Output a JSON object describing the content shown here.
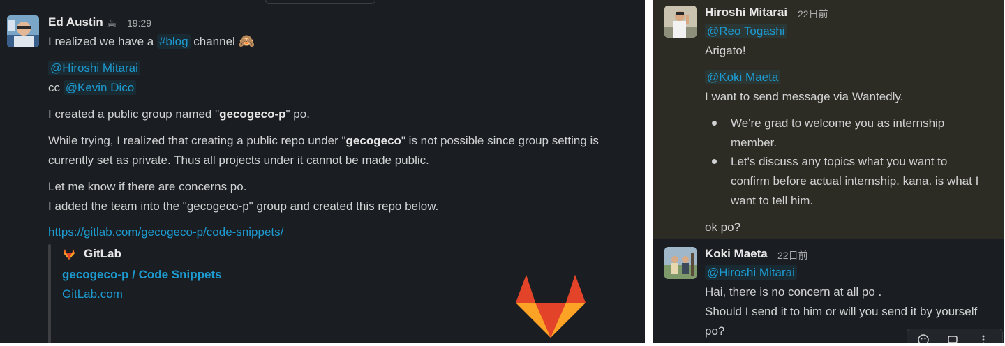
{
  "left": {
    "author": "Ed Austin",
    "status_emoji": "☕",
    "time": "19:29",
    "line1_pre": "I realized we have a ",
    "line1_channel": "#blog",
    "line1_post": " channel",
    "line1_emoji": "🙈",
    "mention_hiroshi": "@Hiroshi Mitarai",
    "cc": "cc ",
    "mention_kevin": "@Kevin Dico",
    "p1_pre": "I created a public group named \"",
    "p1_bold": "gecogeco-p",
    "p1_post": "\" po.",
    "p2_pre": "While trying, I realized that creating a public repo under \"",
    "p2_bold": "gecogeco",
    "p2_post": "\" is not possible since group setting is",
    "p2_line2": "currently set as private. Thus all projects under it cannot be made public.",
    "p3_line1": "Let me know if there are concerns po.",
    "p3_line2": "I added the team into the \"gecogeco-p\" group and created this repo below.",
    "link": "https://gitlab.com/gecogeco-p/code-snippets/",
    "unfurl": {
      "site_name": "GitLab",
      "title": "gecogeco-p / Code Snippets",
      "domain": "GitLab.com"
    }
  },
  "right": {
    "msg1": {
      "author": "Hiroshi Mitarai",
      "time": "22日前",
      "mention_reo": "@Reo Togashi",
      "arigato": "Arigato!",
      "mention_koki": "@Koki Maeta",
      "intro": "I want to send message via Wantedly.",
      "bullet1_line1": "We're grad to welcome you as internship",
      "bullet1_line2": "member.",
      "bullet2_line1": "Let's discuss any topics what you want to",
      "bullet2_line2": "confirm before actual internship. kana. is what I",
      "bullet2_line3": "want to tell him.",
      "closing": "ok po?"
    },
    "msg2": {
      "author": "Koki Maeta",
      "time": "22日前",
      "mention_hiroshi": "@Hiroshi Mitarai",
      "line1": "Hai, there is no concern at all po .",
      "line2": "Should I send it to him or will you send it by yourself",
      "line3": "po?"
    }
  },
  "colors": {
    "background": "#1a1d21",
    "highlight": "#2d2c24",
    "text": "#d1d2d3",
    "link": "#1d9bd1",
    "gitlab_orange": "#fc6d26"
  }
}
